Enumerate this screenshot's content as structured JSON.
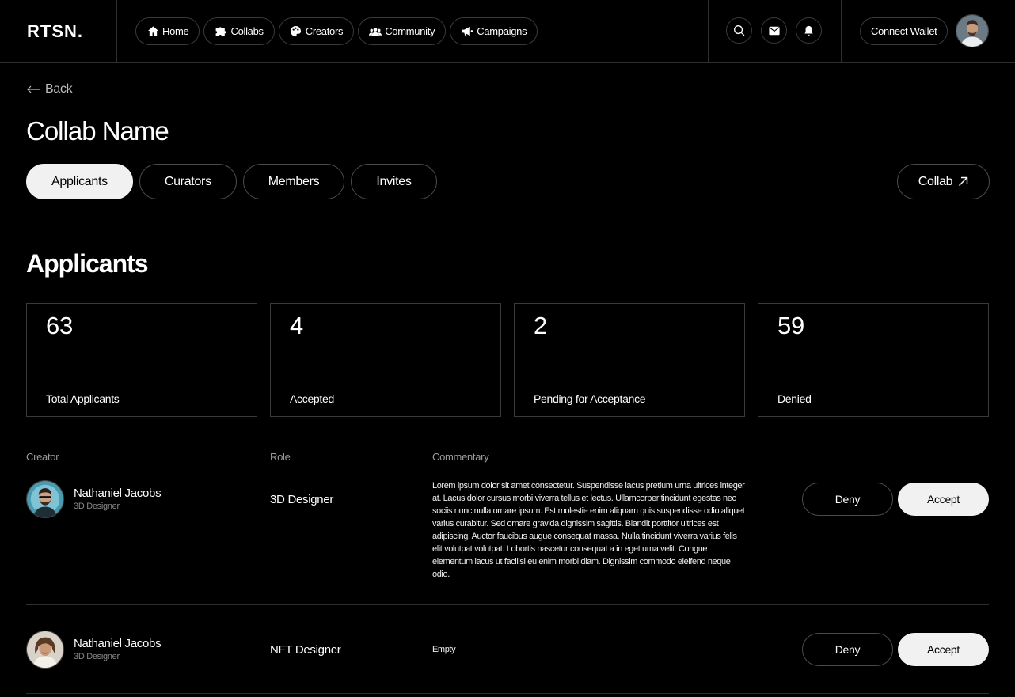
{
  "nav": {
    "logo": "RTSN.",
    "links": [
      {
        "label": "Home",
        "icon": "home-icon"
      },
      {
        "label": "Collabs",
        "icon": "puzzle-icon"
      },
      {
        "label": "Creators",
        "icon": "palette-icon"
      },
      {
        "label": "Community",
        "icon": "users-icon"
      },
      {
        "label": "Campaigns",
        "icon": "megaphone-icon"
      }
    ],
    "icons": [
      "search-icon",
      "mail-icon",
      "bell-icon"
    ],
    "wallet_label": "Connect Wallet"
  },
  "header": {
    "back_label": "Back",
    "title": "Collab Name",
    "tabs": [
      {
        "label": "Applicants",
        "active": true
      },
      {
        "label": "Curators",
        "active": false
      },
      {
        "label": "Members",
        "active": false
      },
      {
        "label": "Invites",
        "active": false
      }
    ],
    "collab_button": "Collab"
  },
  "applicants": {
    "title": "Applicants",
    "stats": [
      {
        "value": "63",
        "label": "Total Applicants"
      },
      {
        "value": "4",
        "label": "Accepted"
      },
      {
        "value": "2",
        "label": "Pending for Acceptance"
      },
      {
        "value": "59",
        "label": "Denied"
      }
    ],
    "columns": [
      "Creator",
      "Role",
      "Commentary"
    ],
    "rows": [
      {
        "name": "Nathaniel Jacobs",
        "subtitle": "3D Designer",
        "role": "3D Designer",
        "commentary": "Lorem ipsum dolor sit amet consectetur. Suspendisse lacus pretium urna ultrices integer at. Lacus dolor cursus morbi viverra tellus et lectus. Ullamcorper tincidunt egestas nec sociis nunc nulla ornare ipsum. Est molestie enim aliquam quis suspendisse odio aliquet varius curabitur. Sed ornare gravida dignissim sagittis. Blandit porttitor ultrices est adipiscing. Auctor faucibus augue consequat massa. Nulla tincidunt viverra varius felis elit volutpat volutpat. Lobortis nascetur consequat a in eget urna velit. Congue elementum lacus ut facilisi eu enim morbi diam. Dignissim commodo eleifend neque odio.",
        "deny_label": "Deny",
        "accept_label": "Accept"
      },
      {
        "name": "Nathaniel Jacobs",
        "subtitle": "3D Designer",
        "role": "NFT Designer",
        "commentary": "Empty",
        "deny_label": "Deny",
        "accept_label": "Accept"
      }
    ]
  },
  "colors": {
    "background": "#000000",
    "text": "#ffffff",
    "accent_light": "#f1f1f1",
    "border": "#3a3a3a"
  }
}
